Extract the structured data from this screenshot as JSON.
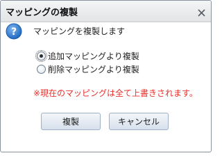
{
  "dialog": {
    "title": "マッピングの複製",
    "close_icon": "close-icon",
    "help_icon": "question-icon",
    "message": "マッピングを複製します",
    "options": [
      {
        "label": "追加マッピングより複製",
        "checked": true
      },
      {
        "label": "削除マッピングより複製",
        "checked": false
      }
    ],
    "warning": "※現在のマッピングは全て上書きされます。",
    "buttons": {
      "copy_label": "複製",
      "cancel_label": "キャンセル"
    },
    "colors": {
      "help_icon_blue": "#2f7fd6",
      "warning_red": "#e8302c"
    }
  }
}
